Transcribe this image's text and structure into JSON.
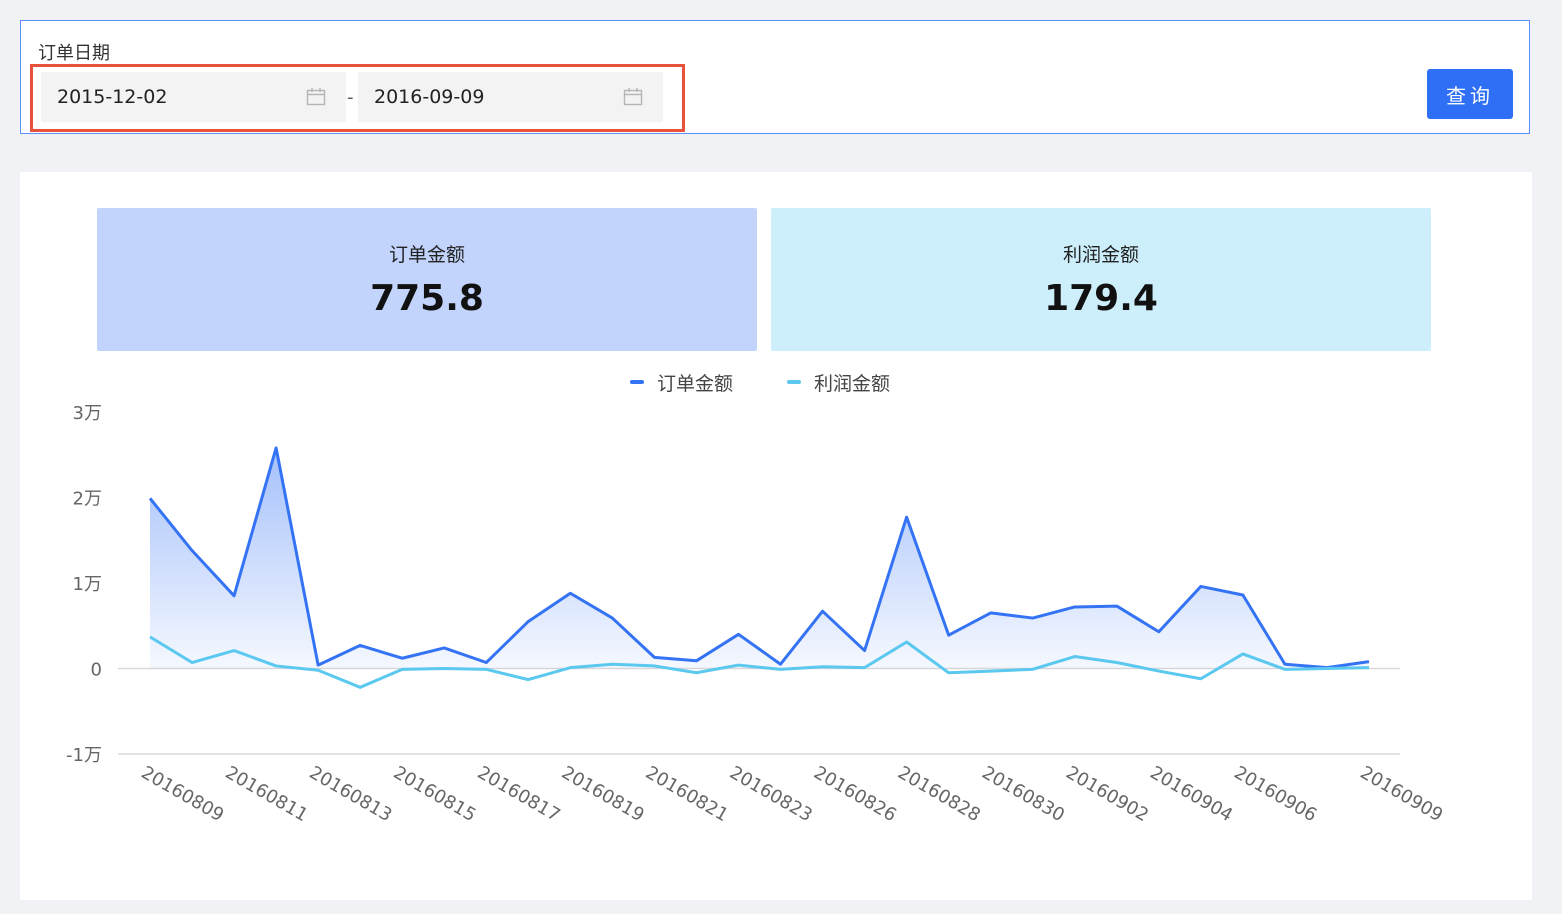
{
  "filter": {
    "label": "订单日期",
    "start_date": "2015-12-02",
    "separator": "-",
    "end_date": "2016-09-09",
    "query_button": "查询"
  },
  "kpis": {
    "order": {
      "label": "订单金额",
      "value": "775.8"
    },
    "profit": {
      "label": "利润金额",
      "value": "179.4"
    }
  },
  "colors": {
    "order_line": "#3573f5",
    "profit_line": "#5bc8ef",
    "order_card": "#c2d4fc",
    "profit_card": "#cdeefb",
    "accent": "#2f6ff5",
    "highlight": "#e8513c"
  },
  "chart_data": {
    "type": "area",
    "y_ticks": [
      {
        "value": 30000,
        "label": "3万"
      },
      {
        "value": 20000,
        "label": "2万"
      },
      {
        "value": 10000,
        "label": "1万"
      },
      {
        "value": 0,
        "label": "0"
      },
      {
        "value": -10000,
        "label": "-1万"
      }
    ],
    "ylim": [
      -10000,
      30000
    ],
    "x_tick_labels": [
      "20160809",
      "20160811",
      "20160813",
      "20160815",
      "20160817",
      "20160819",
      "20160821",
      "20160823",
      "20160826",
      "20160828",
      "20160830",
      "20160902",
      "20160904",
      "20160906",
      "20160909"
    ],
    "x_tick_indices": [
      0,
      2,
      4,
      6,
      8,
      10,
      12,
      14,
      16,
      18,
      20,
      22,
      24,
      26,
      29
    ],
    "legend_placement": "top-center",
    "series": [
      {
        "name": "订单金额",
        "color": "#3573f5",
        "filled": true,
        "values": [
          19900,
          13800,
          8500,
          25800,
          400,
          2700,
          1200,
          2400,
          700,
          5500,
          8800,
          5900,
          1300,
          900,
          4000,
          500,
          6700,
          2100,
          17700,
          3900,
          6500,
          5900,
          7200,
          7300,
          4300,
          9600,
          8600,
          500,
          100,
          800
        ]
      },
      {
        "name": "利润金额",
        "color": "#5bc8ef",
        "filled": false,
        "values": [
          3700,
          700,
          2100,
          300,
          -200,
          -2200,
          -100,
          0,
          -100,
          -1300,
          100,
          500,
          300,
          -500,
          400,
          -100,
          200,
          100,
          3100,
          -500,
          -300,
          -100,
          1400,
          700,
          -300,
          -1200,
          1700,
          -100,
          0,
          100
        ]
      }
    ]
  }
}
